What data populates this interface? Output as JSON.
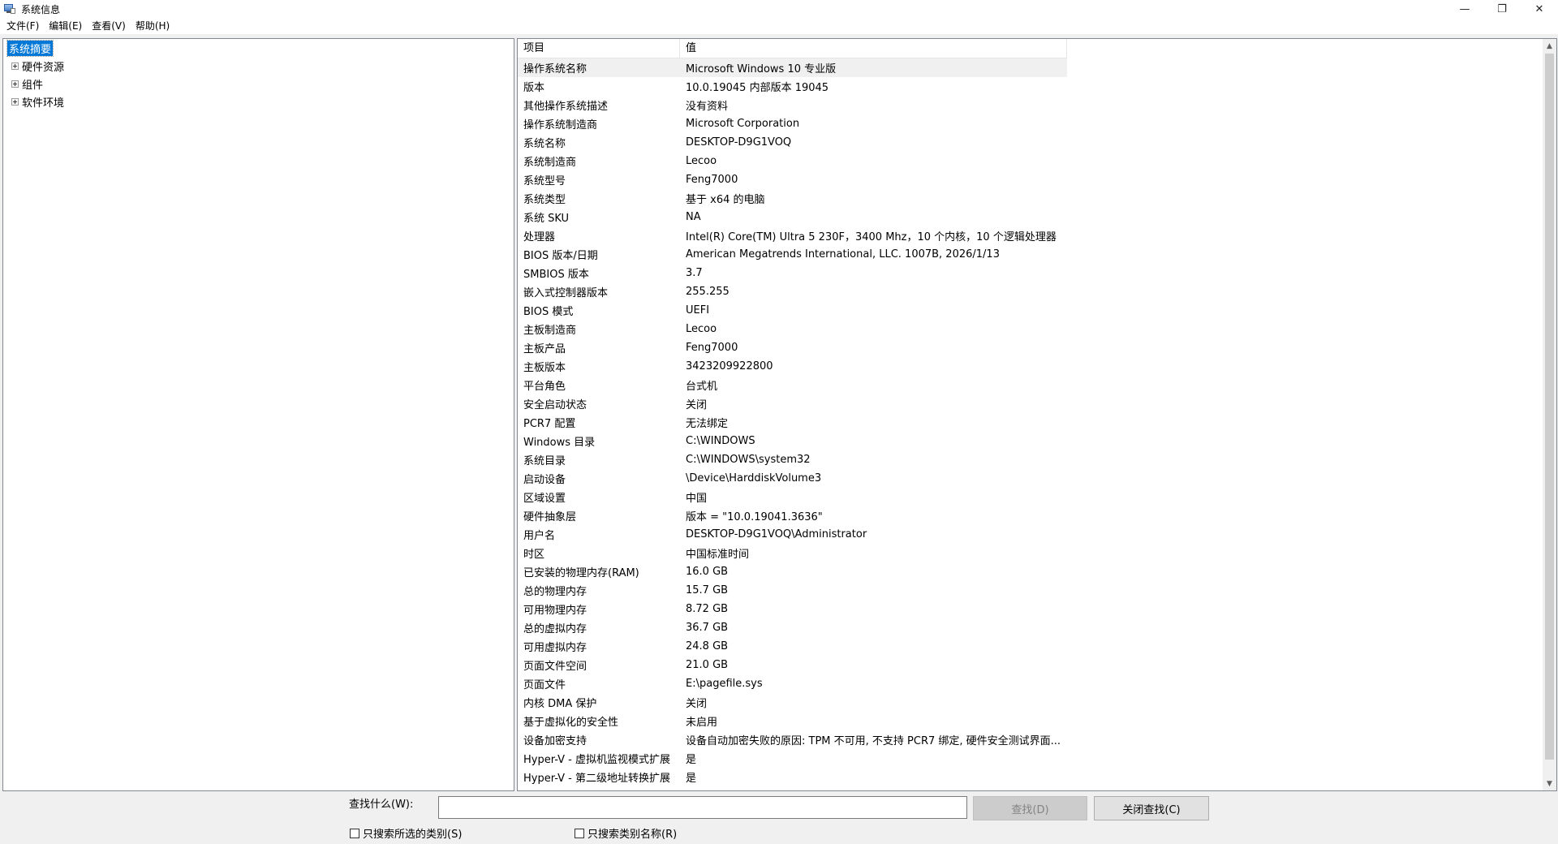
{
  "window": {
    "title": "系统信息",
    "minimize": "—",
    "restore": "❐",
    "close": "✕"
  },
  "menu": [
    "文件(F)",
    "编辑(E)",
    "查看(V)",
    "帮助(H)"
  ],
  "tree": {
    "items": [
      {
        "label": "系统摘要",
        "selected": true
      },
      {
        "label": "硬件资源"
      },
      {
        "label": "组件"
      },
      {
        "label": "软件环境"
      }
    ]
  },
  "table": {
    "headers": [
      "项目",
      "值"
    ],
    "rows": [
      [
        "操作系统名称",
        "Microsoft Windows 10 专业版"
      ],
      [
        "版本",
        "10.0.19045 内部版本 19045"
      ],
      [
        "其他操作系统描述",
        "没有资料"
      ],
      [
        "操作系统制造商",
        "Microsoft Corporation"
      ],
      [
        "系统名称",
        "DESKTOP-D9G1VOQ"
      ],
      [
        "系统制造商",
        "Lecoo"
      ],
      [
        "系统型号",
        "Feng7000"
      ],
      [
        "系统类型",
        "基于 x64 的电脑"
      ],
      [
        "系统 SKU",
        "NA"
      ],
      [
        "处理器",
        "Intel(R) Core(TM) Ultra 5 230F，3400 Mhz，10 个内核，10 个逻辑处理器"
      ],
      [
        "BIOS 版本/日期",
        "American Megatrends International, LLC. 1007B, 2026/1/13"
      ],
      [
        "SMBIOS 版本",
        "3.7"
      ],
      [
        "嵌入式控制器版本",
        "255.255"
      ],
      [
        "BIOS 模式",
        "UEFI"
      ],
      [
        "主板制造商",
        "Lecoo"
      ],
      [
        "主板产品",
        "Feng7000"
      ],
      [
        "主板版本",
        "3423209922800"
      ],
      [
        "平台角色",
        "台式机"
      ],
      [
        "安全启动状态",
        "关闭"
      ],
      [
        "PCR7 配置",
        "无法绑定"
      ],
      [
        "Windows 目录",
        "C:\\WINDOWS"
      ],
      [
        "系统目录",
        "C:\\WINDOWS\\system32"
      ],
      [
        "启动设备",
        "\\Device\\HarddiskVolume3"
      ],
      [
        "区域设置",
        "中国"
      ],
      [
        "硬件抽象层",
        "版本 = \"10.0.19041.3636\""
      ],
      [
        "用户名",
        "DESKTOP-D9G1VOQ\\Administrator"
      ],
      [
        "时区",
        "中国标准时间"
      ],
      [
        "已安装的物理内存(RAM)",
        "16.0 GB"
      ],
      [
        "总的物理内存",
        "15.7 GB"
      ],
      [
        "可用物理内存",
        "8.72 GB"
      ],
      [
        "总的虚拟内存",
        "36.7 GB"
      ],
      [
        "可用虚拟内存",
        "24.8 GB"
      ],
      [
        "页面文件空间",
        "21.0 GB"
      ],
      [
        "页面文件",
        "E:\\pagefile.sys"
      ],
      [
        "内核 DMA 保护",
        "关闭"
      ],
      [
        "基于虚拟化的安全性",
        "未启用"
      ],
      [
        "设备加密支持",
        "设备自动加密失败的原因: TPM 不可用, 不支持 PCR7 绑定, 硬件安全测试界面..."
      ],
      [
        "Hyper-V - 虚拟机监视模式扩展",
        "是"
      ],
      [
        "Hyper-V - 第二级地址转换扩展",
        "是"
      ]
    ]
  },
  "find": {
    "label": "查找什么(W):",
    "value": "",
    "find_button": "查找(D)",
    "close_find_button": "关闭查找(C)",
    "check_selected_category": "只搜索所选的类别(S)",
    "check_category_names": "只搜索类别名称(R)"
  }
}
